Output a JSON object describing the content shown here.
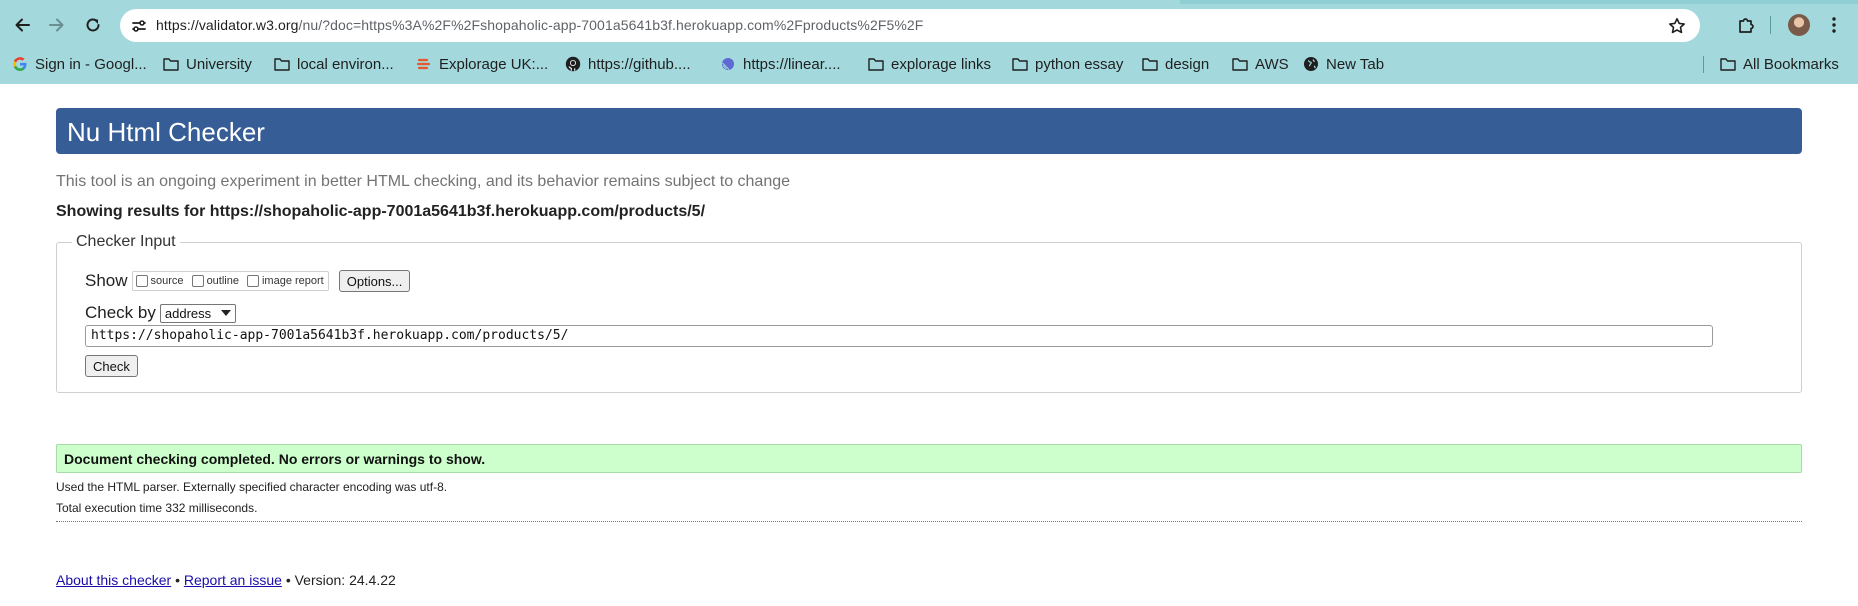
{
  "browser": {
    "url_host": "https://validator.w3.org",
    "url_rest": "/nu/?doc=https%3A%2F%2Fshopaholic-app-7001a5641b3f.herokuapp.com%2Fproducts%2F5%2F",
    "bookmarks": [
      {
        "label": "Sign in - Googl...",
        "icon": "google-icon"
      },
      {
        "label": "University",
        "icon": "folder-icon"
      },
      {
        "label": "local environ...",
        "icon": "folder-icon"
      },
      {
        "label": "Explorage UK:...",
        "icon": "explorage-icon"
      },
      {
        "label": "https://github....",
        "icon": "github-icon"
      },
      {
        "label": "https://linear....",
        "icon": "linear-icon"
      },
      {
        "label": "explorage links",
        "icon": "folder-icon"
      },
      {
        "label": "python essay",
        "icon": "folder-icon"
      },
      {
        "label": "design",
        "icon": "folder-icon"
      },
      {
        "label": "AWS",
        "icon": "folder-icon"
      },
      {
        "label": "New Tab",
        "icon": "globe-icon"
      }
    ],
    "all_bookmarks": "All Bookmarks",
    "colors": {
      "toolbar": "#a3d9dd",
      "omnibox": "#ffffff"
    }
  },
  "page": {
    "title": "Nu Html Checker",
    "tagline": "This tool is an ongoing experiment in better HTML checking, and its behavior remains subject to change",
    "results_for": "Showing results for https://shopaholic-app-7001a5641b3f.herokuapp.com/products/5/",
    "checker": {
      "legend": "Checker Input",
      "show_label": "Show",
      "options": [
        "source",
        "outline",
        "image report"
      ],
      "options_button": "Options...",
      "check_by_label": "Check by",
      "check_by_value": "address",
      "url_value": "https://shopaholic-app-7001a5641b3f.herokuapp.com/products/5/",
      "check_button": "Check"
    },
    "result": {
      "message": "Document checking completed. No errors or warnings to show.",
      "parser_note": "Used the HTML parser. Externally specified character encoding was utf-8.",
      "exec_time": "Total execution time 332 milliseconds."
    },
    "footer": {
      "about": "About this checker",
      "bullet": "•",
      "report": "Report an issue",
      "version": "Version: 24.4.22"
    },
    "colors": {
      "header": "#365d95",
      "success": "#ccffcc",
      "link": "#1a0dab"
    }
  }
}
